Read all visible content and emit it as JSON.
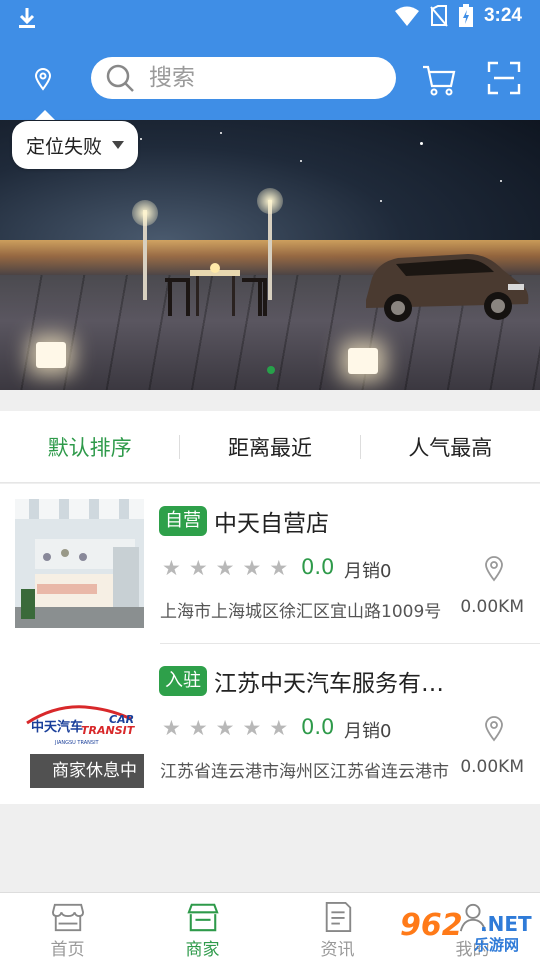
{
  "status_bar": {
    "time": "3:24"
  },
  "header": {
    "search_placeholder": "搜索",
    "location_status": "定位失败"
  },
  "sort_tabs": [
    {
      "label": "默认排序",
      "active": true
    },
    {
      "label": "距离最近",
      "active": false
    },
    {
      "label": "人气最高",
      "active": false
    }
  ],
  "stores": [
    {
      "tag": "自营",
      "name": "中天自营店",
      "rating": "0.0",
      "rating_stars": 0,
      "sales": "月销0",
      "address": "上海市上海城区徐汇区宜山路1009号",
      "distance": "0.00KM"
    },
    {
      "tag": "入驻",
      "name": "江苏中天汽车服务有限公司",
      "rating": "0.0",
      "rating_stars": 0,
      "sales": "月销0",
      "address": "江苏省连云港市海州区江苏省连云港市",
      "distance": "0.00KM",
      "status": "商家休息中",
      "logo": {
        "brand": "中天汽车",
        "car": "CAR",
        "transit": "TRANSIT",
        "sub": "JIANGSU TRANSIT"
      }
    }
  ],
  "bottom_nav": [
    {
      "label": "首页",
      "icon": "store-front-icon",
      "active": false
    },
    {
      "label": "商家",
      "icon": "merchant-icon",
      "active": true
    },
    {
      "label": "资讯",
      "icon": "news-icon",
      "active": false
    },
    {
      "label": "我的",
      "icon": "profile-icon",
      "active": false
    }
  ],
  "watermark": {
    "number": "962",
    "net": ".NET",
    "site": "乐游网"
  },
  "colors": {
    "primary": "#3f8ee6",
    "accent_green": "#2e9a4a",
    "background": "#efefef"
  }
}
